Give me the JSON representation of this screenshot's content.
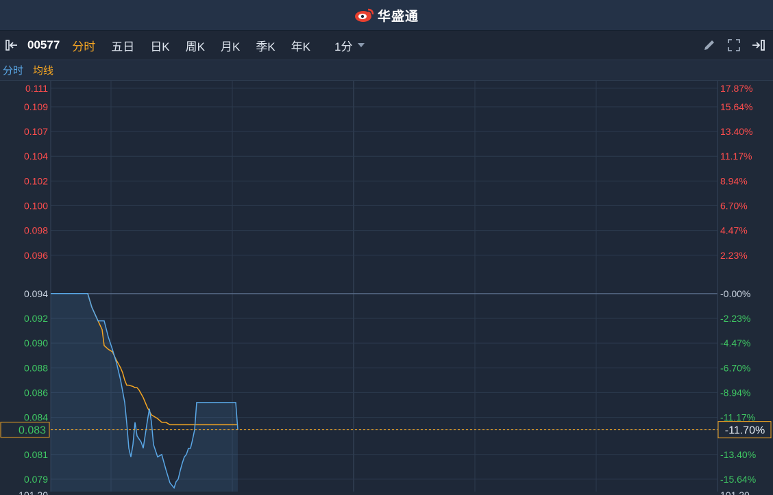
{
  "brand": {
    "name": "华盛通",
    "logo_icon": "weibo-eye-logo-icon",
    "logo_color": "#e8402f"
  },
  "toolbar": {
    "collapse_icon": "collapse-panel-icon",
    "stock_code": "00577",
    "tabs": [
      {
        "label": "分时",
        "active": true
      },
      {
        "label": "五日",
        "active": false
      },
      {
        "label": "日K",
        "active": false
      },
      {
        "label": "周K",
        "active": false
      },
      {
        "label": "月K",
        "active": false
      },
      {
        "label": "季K",
        "active": false
      },
      {
        "label": "年K",
        "active": false
      }
    ],
    "interval": "1分",
    "right_icons": [
      "pencil-icon",
      "fullscreen-icon",
      "exit-icon"
    ]
  },
  "legend": [
    {
      "label": "分时",
      "color": "#5aa7e6"
    },
    {
      "label": "均线",
      "color": "#f5a623"
    }
  ],
  "chart_data": {
    "type": "line",
    "prev_close": 0.094,
    "ylim": [
      0.078,
      0.1112
    ],
    "left_ticks": [
      "0.111",
      "0.109",
      "0.107",
      "0.104",
      "0.102",
      "0.100",
      "0.098",
      "0.096",
      "0.094",
      "0.092",
      "0.090",
      "0.088",
      "0.086",
      "0.084",
      "0.083",
      "0.081",
      "0.079"
    ],
    "left_tick_values": [
      0.1106,
      0.1091,
      0.1071,
      0.1051,
      0.1031,
      0.1011,
      0.0991,
      0.0971,
      0.094,
      0.092,
      0.09,
      0.088,
      0.086,
      0.084,
      0.083,
      0.081,
      0.079
    ],
    "right_ticks": [
      "17.87%",
      "15.64%",
      "13.40%",
      "11.17%",
      "8.94%",
      "6.70%",
      "4.47%",
      "2.23%",
      "-0.00%",
      "-2.23%",
      "-4.47%",
      "-6.70%",
      "-8.94%",
      "-11.17%",
      "-13.40%",
      "-15.64%"
    ],
    "right_tick_values": [
      0.1106,
      0.1091,
      0.1071,
      0.1051,
      0.1031,
      0.1011,
      0.0991,
      0.0971,
      0.094,
      0.092,
      0.09,
      0.088,
      0.086,
      0.084,
      0.081,
      0.079
    ],
    "current_price_label": "0.083",
    "current_pct_label": "-11.70%",
    "current_price": 0.083,
    "bottom_left_label": "101.20",
    "bottom_right_label": "101.20",
    "up_color": "#ff4d4d",
    "down_color": "#3fc763",
    "neutral_color": "#c9d3e0",
    "x_max": 242,
    "series": [
      {
        "name": "分时",
        "color": "#5aa7e6",
        "x": [
          0,
          18,
          20,
          23,
          26,
          28,
          30,
          32,
          34,
          36,
          37,
          38,
          39,
          40,
          41,
          42,
          44,
          45,
          46,
          47,
          48,
          49,
          50,
          52,
          54,
          56,
          58,
          60,
          61,
          62,
          63,
          64,
          65,
          66,
          67,
          68,
          69,
          70,
          71,
          72,
          75,
          85,
          90,
          91
        ],
        "y": [
          0.094,
          0.094,
          0.0929,
          0.0918,
          0.0918,
          0.0905,
          0.0895,
          0.0884,
          0.087,
          0.0852,
          0.0835,
          0.0815,
          0.0808,
          0.0818,
          0.0836,
          0.0825,
          0.082,
          0.0815,
          0.0826,
          0.0837,
          0.0847,
          0.0836,
          0.0818,
          0.0808,
          0.081,
          0.0798,
          0.0787,
          0.0783,
          0.0788,
          0.079,
          0.0797,
          0.0803,
          0.0808,
          0.081,
          0.0815,
          0.0815,
          0.0822,
          0.083,
          0.0852,
          0.0852,
          0.0852,
          0.0852,
          0.0852,
          0.083
        ]
      },
      {
        "name": "均线",
        "color": "#f5a623",
        "x": [
          0,
          18,
          20,
          23,
          25,
          26,
          28,
          30,
          32,
          34,
          35,
          36,
          37,
          38,
          40,
          41,
          42,
          43,
          44,
          45,
          47,
          49,
          52,
          54,
          56,
          58,
          60,
          70,
          91
        ],
        "y": [
          0.094,
          0.094,
          0.0929,
          0.0918,
          0.0911,
          0.0898,
          0.0895,
          0.0893,
          0.0886,
          0.088,
          0.0876,
          0.087,
          0.0866,
          0.0866,
          0.0865,
          0.0864,
          0.0864,
          0.0862,
          0.0859,
          0.0856,
          0.0848,
          0.0842,
          0.0839,
          0.0836,
          0.0836,
          0.0834,
          0.0834,
          0.0834,
          0.0834
        ]
      }
    ]
  }
}
